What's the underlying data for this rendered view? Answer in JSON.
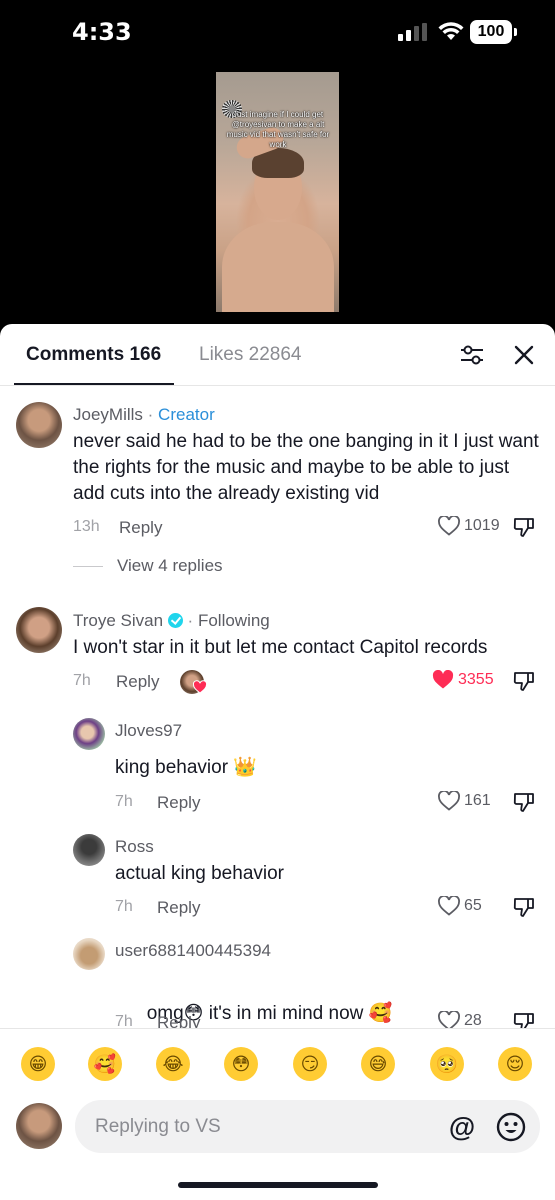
{
  "status_bar": {
    "time": "4:33",
    "battery": "100"
  },
  "video": {
    "caption": "Just imagine if I could get @troyesivan to make a alt music vid that wasn't safe for work"
  },
  "tabs": {
    "comments": "Comments 166",
    "likes": "Likes 22864"
  },
  "comments": [
    {
      "username": "JoeyMills",
      "separator": "·",
      "badge": "Creator",
      "text": "never said he had to be the one banging in it I just want the rights for the music and maybe to be able to just add cuts into the already existing vid",
      "time": "13h",
      "reply": "Reply",
      "likes": "1019",
      "view_replies": "View 4 replies"
    },
    {
      "username": "Troye Sivan",
      "separator": "·",
      "badge": "Following",
      "text": "I won't star in it but let me contact Capitol records",
      "time": "7h",
      "reply": "Reply",
      "likes": "3355",
      "liked": true,
      "replies": [
        {
          "username": "Jloves97",
          "text": "king behavior",
          "emoji": "👑",
          "time": "7h",
          "reply": "Reply",
          "likes": "161"
        },
        {
          "username": "Ross",
          "text": "actual king behavior",
          "time": "7h",
          "reply": "Reply",
          "likes": "65"
        },
        {
          "username": "user6881400445394",
          "text_before": "omg",
          "emoji1": "😳",
          "text_after": " it's in mi mind now ",
          "emoji2": "🥰",
          "time": "7h",
          "reply": "Reply",
          "likes": "28"
        }
      ]
    }
  ],
  "quick_emojis": [
    "😁",
    "🥰",
    "😂",
    "😳",
    "😏",
    "😅",
    "🥺",
    "😌"
  ],
  "composer": {
    "placeholder": "Replying to VS",
    "mention_symbol": "@"
  },
  "colors": {
    "accent_like": "#fe2c55",
    "creator_link": "#2b8fd9",
    "verified": "#20d5ec"
  }
}
